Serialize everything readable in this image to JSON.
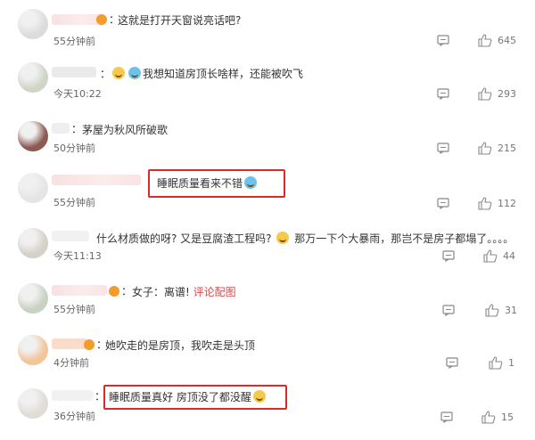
{
  "comments": [
    {
      "text": "这就是打开天窗说亮话吧?",
      "time": "55分钟前",
      "likes": "645"
    },
    {
      "text": "我想知道房顶长啥样，还能被吹飞",
      "time": "今天10:22",
      "likes": "293"
    },
    {
      "text": "茅屋为秋风所破歌",
      "time": "50分钟前",
      "likes": "215"
    },
    {
      "text": "睡眠质量看来不错",
      "time": "55分钟前",
      "likes": "112"
    },
    {
      "text": "什么材质做的呀? 又是豆腐渣工程吗? ",
      "text2": "那万一下个大暴雨，那岂不是房子都塌了。。。。",
      "time": "今天11:13",
      "likes": "44"
    },
    {
      "text": "女子：离谱!",
      "link": "评论配图",
      "time": "55分钟前",
      "likes": "31"
    },
    {
      "text": "她吹走的是房顶，我吹走是头顶",
      "time": "4分钟前",
      "likes": "1"
    },
    {
      "text": "睡眠质量真好 房顶没了都没醒",
      "time": "36分钟前",
      "likes": "15"
    }
  ],
  "icons": {
    "comment": "comment-icon",
    "like": "thumbs-up-icon"
  },
  "colors": {
    "highlight": "#d92b2b",
    "link": "#d64b4b"
  }
}
